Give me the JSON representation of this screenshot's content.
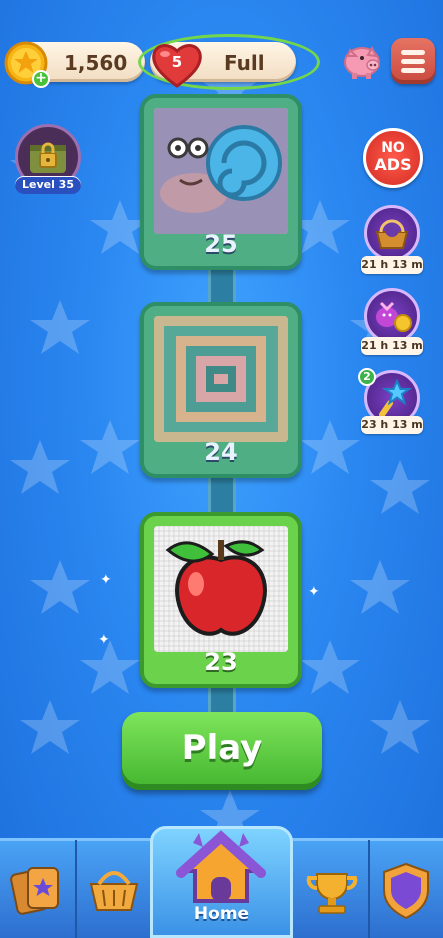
{
  "header": {
    "coins": "1,560",
    "lives_count": "5",
    "lives_status": "Full"
  },
  "side_left": {
    "level_label": "Level 35"
  },
  "side_right": {
    "no_ads_line1": "NO",
    "no_ads_line2": "ADS",
    "event_timers": [
      "21 h 13 m",
      "21 h 13 m",
      "23 h 13 m"
    ],
    "event_badge": "2"
  },
  "levels": [
    {
      "number": "25",
      "state": "locked"
    },
    {
      "number": "24",
      "state": "locked"
    },
    {
      "number": "23",
      "state": "current"
    }
  ],
  "play_label": "Play",
  "bottom_nav": {
    "home_label": "Home"
  },
  "colors": {
    "background": "#2a86f0",
    "play_green": "#43b42f",
    "lives_ring": "#74d64a",
    "heart_red": "#e03a3a"
  }
}
